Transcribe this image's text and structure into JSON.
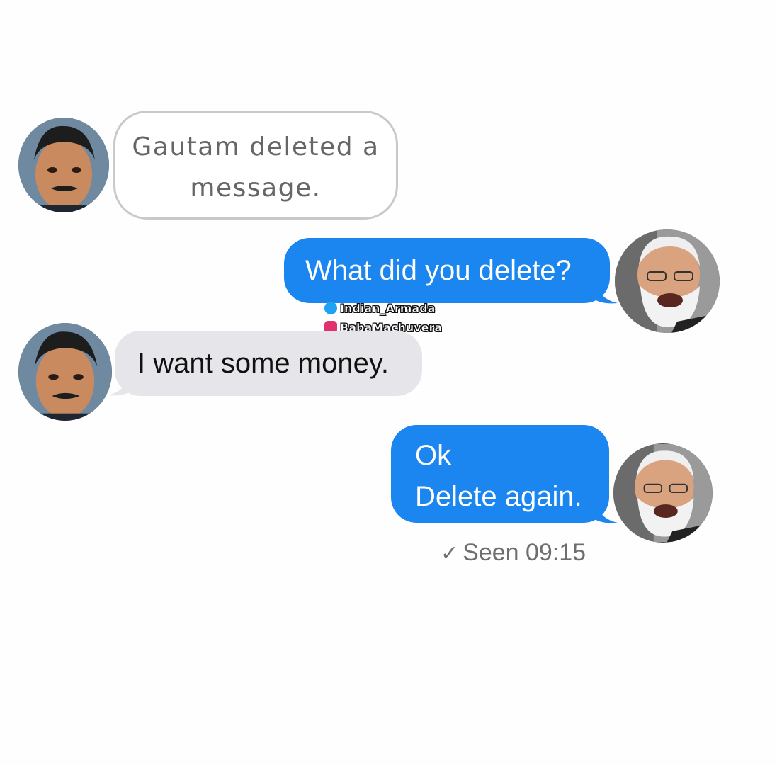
{
  "messages": {
    "deleted": {
      "line1_name": "Gautam",
      "line1_rest": "deleted  a",
      "line2": "message."
    },
    "what": "What did you delete?",
    "want": "I want some money.",
    "ok": {
      "line1": "Ok",
      "line2": "Delete again."
    }
  },
  "watermark": {
    "twitter": "Indian_Armada",
    "instagram": "BabaMachuvera"
  },
  "status": {
    "check": "✓",
    "seen": "Seen 09:15"
  },
  "colors": {
    "sent_bubble": "#1b86f0",
    "received_bubble": "#e6e5ea",
    "deleted_border": "#c9c9c9",
    "status_text": "#6e6e6e"
  },
  "icons": [
    "user-avatar-icon",
    "twitter-icon",
    "instagram-icon",
    "checkmark-icon"
  ]
}
